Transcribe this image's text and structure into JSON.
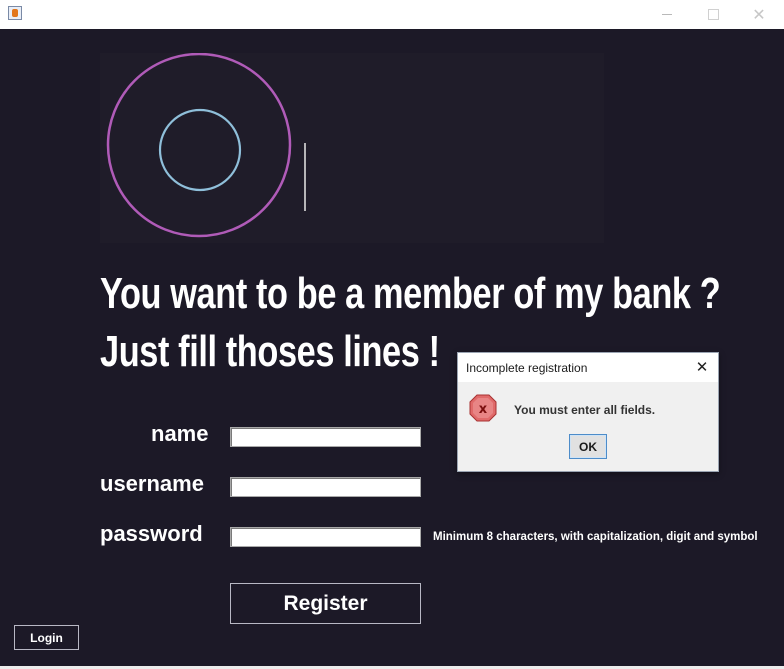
{
  "window": {
    "icon": "java-cup-icon",
    "minimize_glyph": "",
    "maximize_glyph": "",
    "close_glyph": "✕"
  },
  "logo": {
    "description_icon": "concentric-rings-logo",
    "outer_ring_color": "#b05bb8",
    "inner_ring_color": "#8fbfda",
    "cursor_line_color": "#e8e8e8"
  },
  "headline": {
    "line1": "You want to be a member of my bank ?",
    "line2": "Just fill thoses lines !"
  },
  "form": {
    "name_label": "name",
    "username_label": "username",
    "password_label": "password",
    "name_value": "",
    "username_value": "",
    "password_value": "",
    "password_hint": "Minimum 8 characters,  with capitalization, digit and symbol",
    "register_label": "Register"
  },
  "login_label": "Login",
  "dialog": {
    "title": "Incomplete registration",
    "close_glyph": "✕",
    "icon": "error-icon",
    "message": "You must enter all fields.",
    "ok_label": "OK"
  },
  "colors": {
    "background": "#1c1927",
    "text": "#ffffff",
    "error_red": "#d43b3b"
  }
}
